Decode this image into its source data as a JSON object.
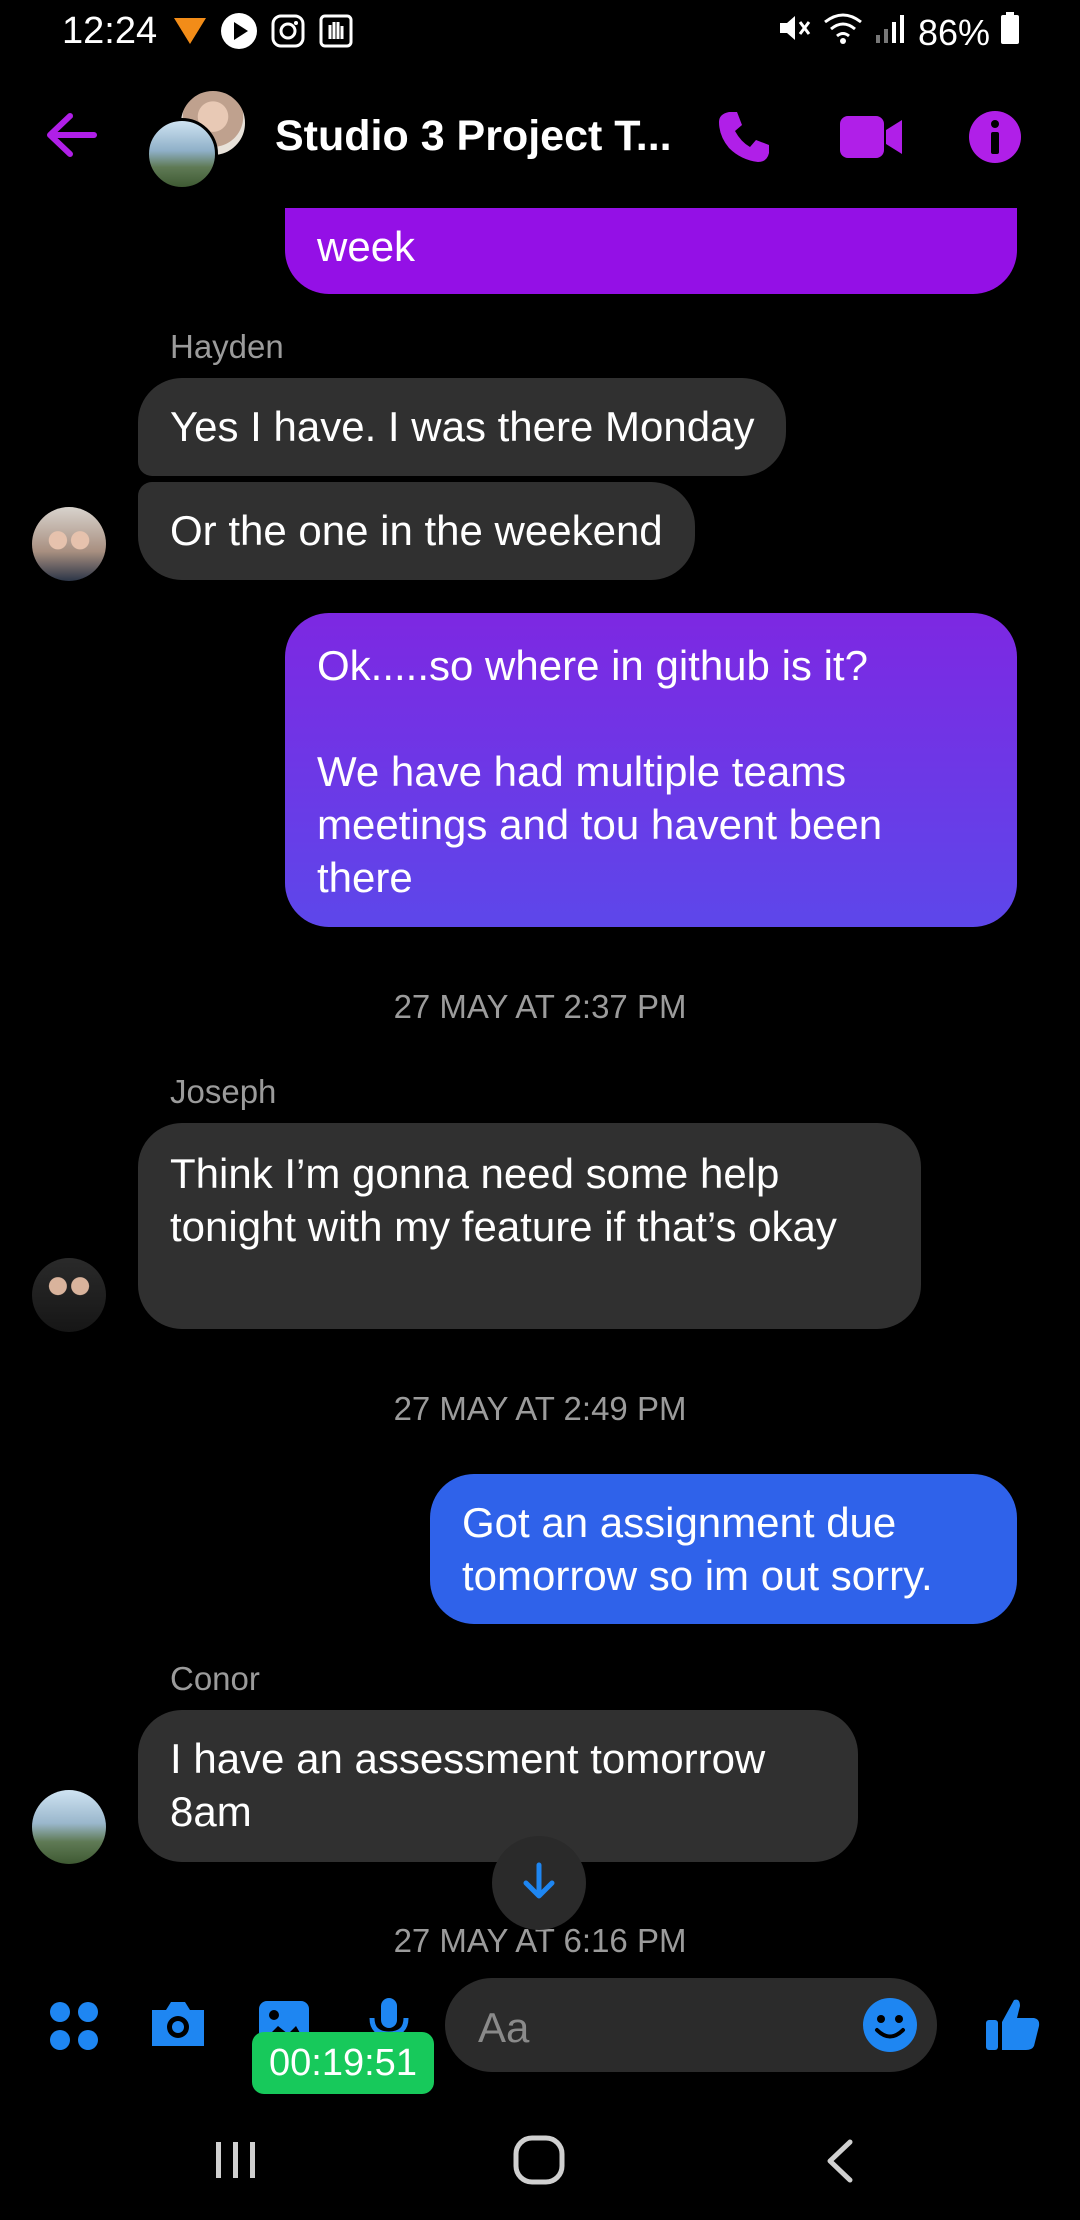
{
  "status_bar": {
    "time": "12:24",
    "battery": "86%",
    "icons_left": [
      "notification-app-icon",
      "play-icon",
      "instagram-icon",
      "hand-icon"
    ],
    "icons_right": [
      "mute-icon",
      "wifi-icon",
      "signal-icon",
      "battery-icon"
    ]
  },
  "header": {
    "title": "Studio 3 Project T...",
    "accent_color": "#b01fe8"
  },
  "messages": [
    {
      "type": "outgoing",
      "text": "week"
    },
    {
      "type": "sender",
      "text": "Hayden"
    },
    {
      "type": "incoming",
      "text": "Yes I have. I was there Monday"
    },
    {
      "type": "incoming",
      "text": "Or the one in the weekend"
    },
    {
      "type": "outgoing",
      "text": "Ok.....so where in github is it?\n\nWe have had multiple teams meetings and tou havent been there"
    },
    {
      "type": "timestamp",
      "text": "27 MAY AT 2:37 PM"
    },
    {
      "type": "sender",
      "text": "Joseph"
    },
    {
      "type": "incoming",
      "text": "Think I’m gonna need some help tonight with my feature if that’s okay"
    },
    {
      "type": "timestamp",
      "text": "27 MAY AT 2:49 PM"
    },
    {
      "type": "outgoing",
      "text": "Got an assignment due tomorrow so im out sorry."
    },
    {
      "type": "sender",
      "text": "Conor"
    },
    {
      "type": "incoming",
      "text": "I have an assessment tomorrow 8am"
    },
    {
      "type": "timestamp",
      "text": "27 MAY AT 6:16 PM"
    }
  ],
  "composer": {
    "placeholder": "Aa",
    "timer": "00:19:51",
    "icon_color": "#1e86f2"
  },
  "nav_bar": {
    "items": [
      "recents-icon",
      "home-icon",
      "back-icon"
    ]
  }
}
